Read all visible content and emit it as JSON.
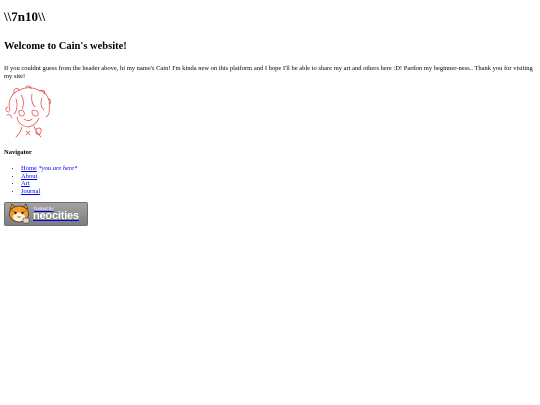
{
  "site": {
    "title": "\\\\7n10\\\\",
    "welcome": "Welcome to Cain's website!",
    "intro": "If you couldnt guess from the header above, hi my name's Cain! I'm kinda new on this platform and I hope I'll be able to share my art and others here :D! Pardon my beginner-ness.. Thank you for visiting my site!"
  },
  "navigator": {
    "heading": "Navigator",
    "items": [
      {
        "label": "Home",
        "note": "*you are here*"
      },
      {
        "label": "About"
      },
      {
        "label": "Art"
      },
      {
        "label": "Journal"
      }
    ]
  },
  "badge": {
    "small": "hosted by",
    "big": "neocities",
    "icon": "neocities-cat-icon"
  },
  "colors": {
    "link": "#0000ee",
    "drawing": "#e0403f",
    "badge_bg": "#8f8f8f"
  }
}
